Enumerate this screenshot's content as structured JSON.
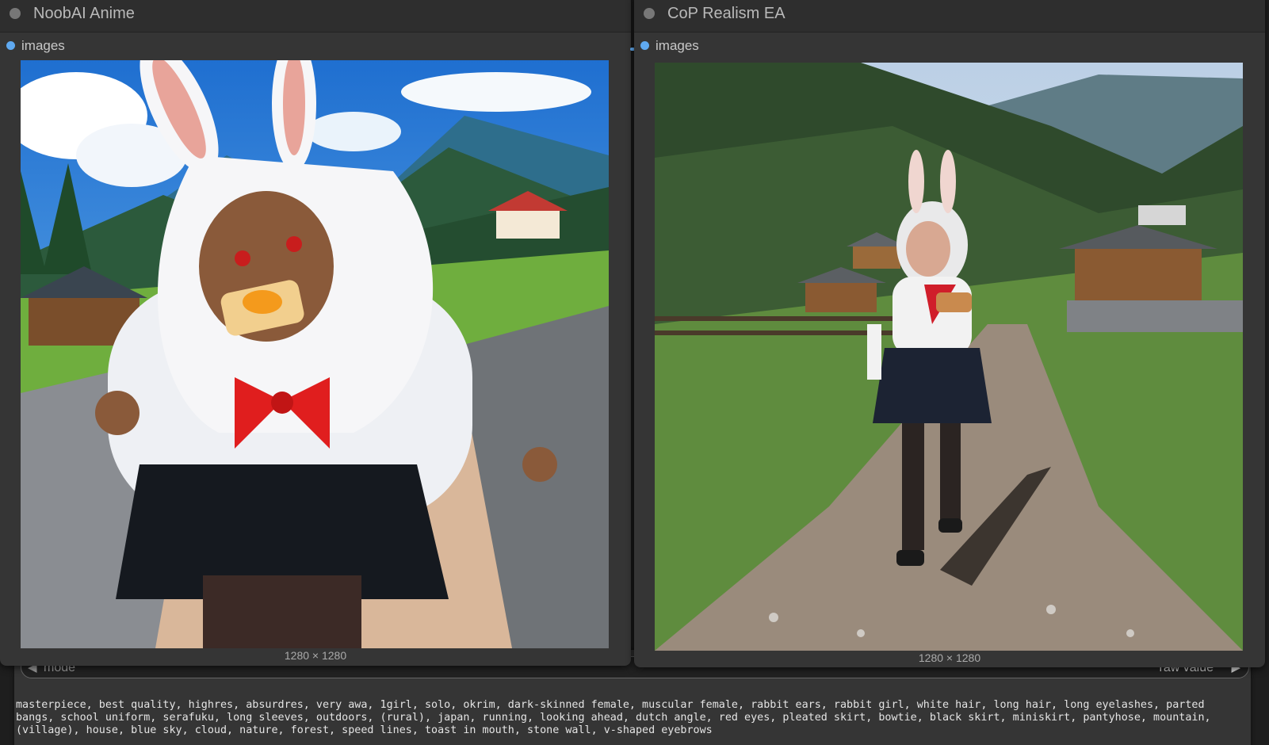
{
  "background_node": {
    "mode_label": "mode",
    "mode_value": "raw value",
    "prompt_text": "masterpiece, best quality, highres, absurdres, very awa, 1girl, solo, okrim, dark-skinned female, muscular female, rabbit ears, rabbit girl, white hair, long hair, long eyelashes, parted bangs, school uniform, serafuku, long sleeves, outdoors, (rural), japan, running, looking ahead, dutch angle, red eyes, pleated skirt, bowtie, black skirt, miniskirt, pantyhose, mountain, (village), house, blue sky, cloud, nature, forest, speed lines, toast in mouth, stone wall, v-shaped eyebrows"
  },
  "nodes": [
    {
      "title": "NoobAI Anime",
      "slot_label": "images",
      "image_size": "1280 × 1280"
    },
    {
      "title": "CoP Realism EA",
      "slot_label": "images",
      "image_size": "1280 × 1280"
    }
  ],
  "colors": {
    "slot_dot": "#5fa9f0",
    "node_bg": "#353535",
    "canvas_bg": "#1e1e1e"
  }
}
